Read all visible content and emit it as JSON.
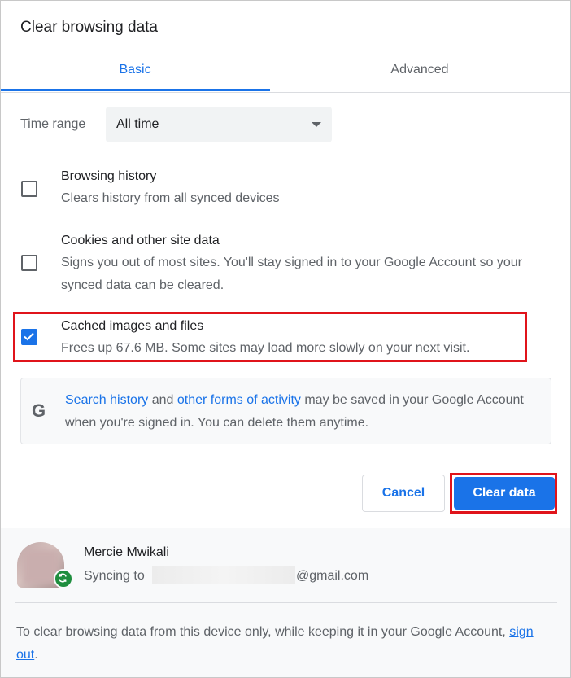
{
  "dialog": {
    "title": "Clear browsing data"
  },
  "tabs": [
    {
      "label": "Basic",
      "selected": true
    },
    {
      "label": "Advanced",
      "selected": false
    }
  ],
  "time_range": {
    "label": "Time range",
    "value": "All time"
  },
  "options": [
    {
      "title": "Browsing history",
      "description": "Clears history from all synced devices",
      "checked": false
    },
    {
      "title": "Cookies and other site data",
      "description": "Signs you out of most sites. You'll stay signed in to your Google Account so your synced data can be cleared.",
      "checked": false
    },
    {
      "title": "Cached images and files",
      "description": "Frees up 67.6 MB. Some sites may load more slowly on your next visit.",
      "checked": true
    }
  ],
  "info": {
    "icon": "google-g-icon",
    "link1": "Search history",
    "text1": " and ",
    "link2": "other forms of activity",
    "text2": " may be saved in your Google Account when you're signed in. You can delete them anytime."
  },
  "buttons": {
    "cancel": "Cancel",
    "clear": "Clear data"
  },
  "account": {
    "name": "Mercie Mwikali",
    "sync_label": "Syncing to",
    "email_domain": "@gmail.com"
  },
  "footer": {
    "text": "To clear browsing data from this device only, while keeping it in your Google Account, ",
    "link": "sign out",
    "end": "."
  },
  "colors": {
    "accent": "#1a73e8",
    "highlight": "#e0141b",
    "sync": "#1e8e3e"
  }
}
